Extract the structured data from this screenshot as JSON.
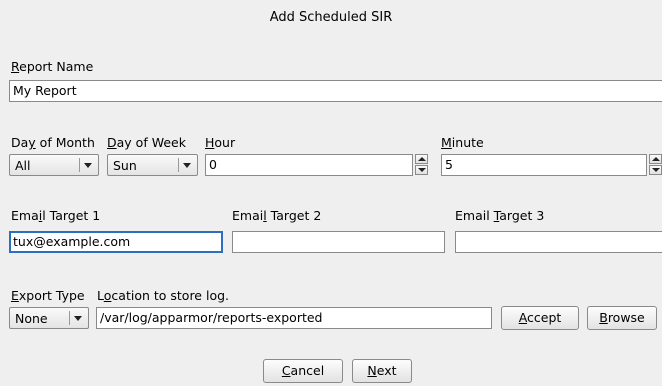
{
  "window": {
    "title": "Add Scheduled SIR"
  },
  "report": {
    "label": "Report Name",
    "value": "My Report"
  },
  "schedule": {
    "day_of_month": {
      "label": "Day of Month",
      "value": "All"
    },
    "day_of_week": {
      "label": "Day of Week",
      "value": "Sun"
    },
    "hour": {
      "label": "Hour",
      "value": "0"
    },
    "minute": {
      "label": "Minute",
      "value": "5"
    }
  },
  "email": {
    "target1": {
      "label": "Email Target 1",
      "value": "tux@example.com"
    },
    "target2": {
      "label": "Email Target 2",
      "value": ""
    },
    "target3": {
      "label": "Email Target 3",
      "value": ""
    }
  },
  "export": {
    "type_label": "Export Type",
    "type_value": "None",
    "location_label": "Location to store log.",
    "location_value": "/var/log/apparmor/reports-exported"
  },
  "buttons": {
    "accept": "Accept",
    "browse": "Browse",
    "cancel": "Cancel",
    "next": "Next"
  },
  "colors": {
    "focus": "#2c6fbf",
    "background": "#efefef"
  }
}
